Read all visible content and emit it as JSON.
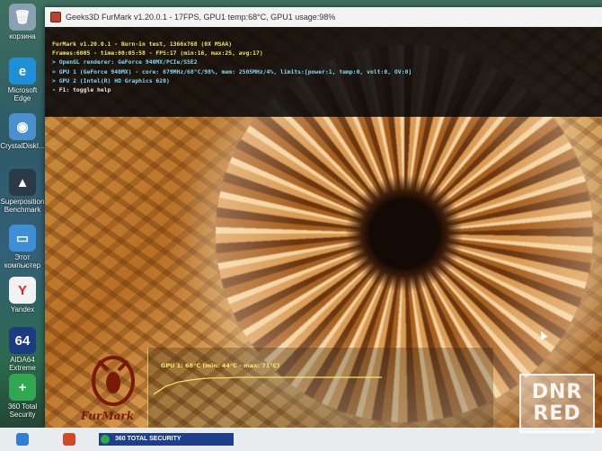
{
  "window": {
    "title": "Geeks3D FurMark v1.20.0.1 - 17FPS, GPU1 temp:68°C, GPU1 usage:98%"
  },
  "overlay": {
    "lines": [
      {
        "text": "FurMark v1.20.0.1 - Burn-in test, 1366x768 (0X MSAA)",
        "color": "yellow"
      },
      {
        "text": "Frames:6005 - time:00:05:58 - FPS:17 (min:16, max:25, avg:17)",
        "color": "yellow"
      },
      {
        "text": "> OpenGL renderer: GeForce 940MX/PCIe/SSE2",
        "color": "cyan"
      },
      {
        "text": "> GPU 1 (GeForce 940MX) - core: 679MHz/68°C/98%, mem: 2505MHz/4%, limits:[power:1, temp:0, volt:0, OV:0]",
        "color": "cyan"
      },
      {
        "text": "> GPU 2 (Intel(R) HD Graphics 620)",
        "color": "cyan"
      },
      {
        "text": "- F1: toggle help",
        "color": "white"
      }
    ]
  },
  "graph": {
    "label": "GPU 1: 68°C (min: 44°C - max: 71°C)",
    "temps": [
      44,
      55,
      61,
      64,
      66,
      67,
      67,
      68,
      68,
      68,
      68,
      68,
      68,
      68,
      68,
      68,
      68,
      68,
      68,
      68
    ],
    "ylim": [
      0,
      100
    ]
  },
  "logo": {
    "brand": "FurMark"
  },
  "desktop_icons": [
    {
      "label": "корзина",
      "icon": "recycle-bin-icon",
      "color": "#8aa1b3"
    },
    {
      "label": "Microsoft Edge",
      "icon": "edge-icon",
      "color": "#1f8fd6"
    },
    {
      "label": "CrystalDiskI...",
      "icon": "crystaldisk-icon",
      "color": "#4a8fd0"
    },
    {
      "label": "Superposition Benchmark",
      "icon": "superposition-icon",
      "color": "#2c3a48"
    },
    {
      "label": "Этот компьютер",
      "icon": "computer-icon",
      "color": "#3e8ed8"
    },
    {
      "label": "Yandex",
      "icon": "yandex-icon",
      "color": "#f2f2f2"
    },
    {
      "label": "AIDA64 Extreme",
      "icon": "aida64-icon",
      "color": "#1c3c82"
    },
    {
      "label": "360 Total Security",
      "icon": "security-icon",
      "color": "#2fa84f"
    }
  ],
  "icon_glyphs": {
    "recycle-bin-icon": "🗑",
    "edge-icon": "e",
    "crystaldisk-icon": "◉",
    "superposition-icon": "▲",
    "computer-icon": "▭",
    "yandex-icon": "Y",
    "aida64-icon": "64",
    "security-icon": "+"
  },
  "notification": {
    "text": "360 TOTAL SECURITY"
  },
  "watermark": {
    "line1": "DNR",
    "line2": "RED"
  },
  "colors": {
    "yellow": "#f4e35b",
    "cyan": "#7fd8f2",
    "white": "#e6e6e6"
  }
}
